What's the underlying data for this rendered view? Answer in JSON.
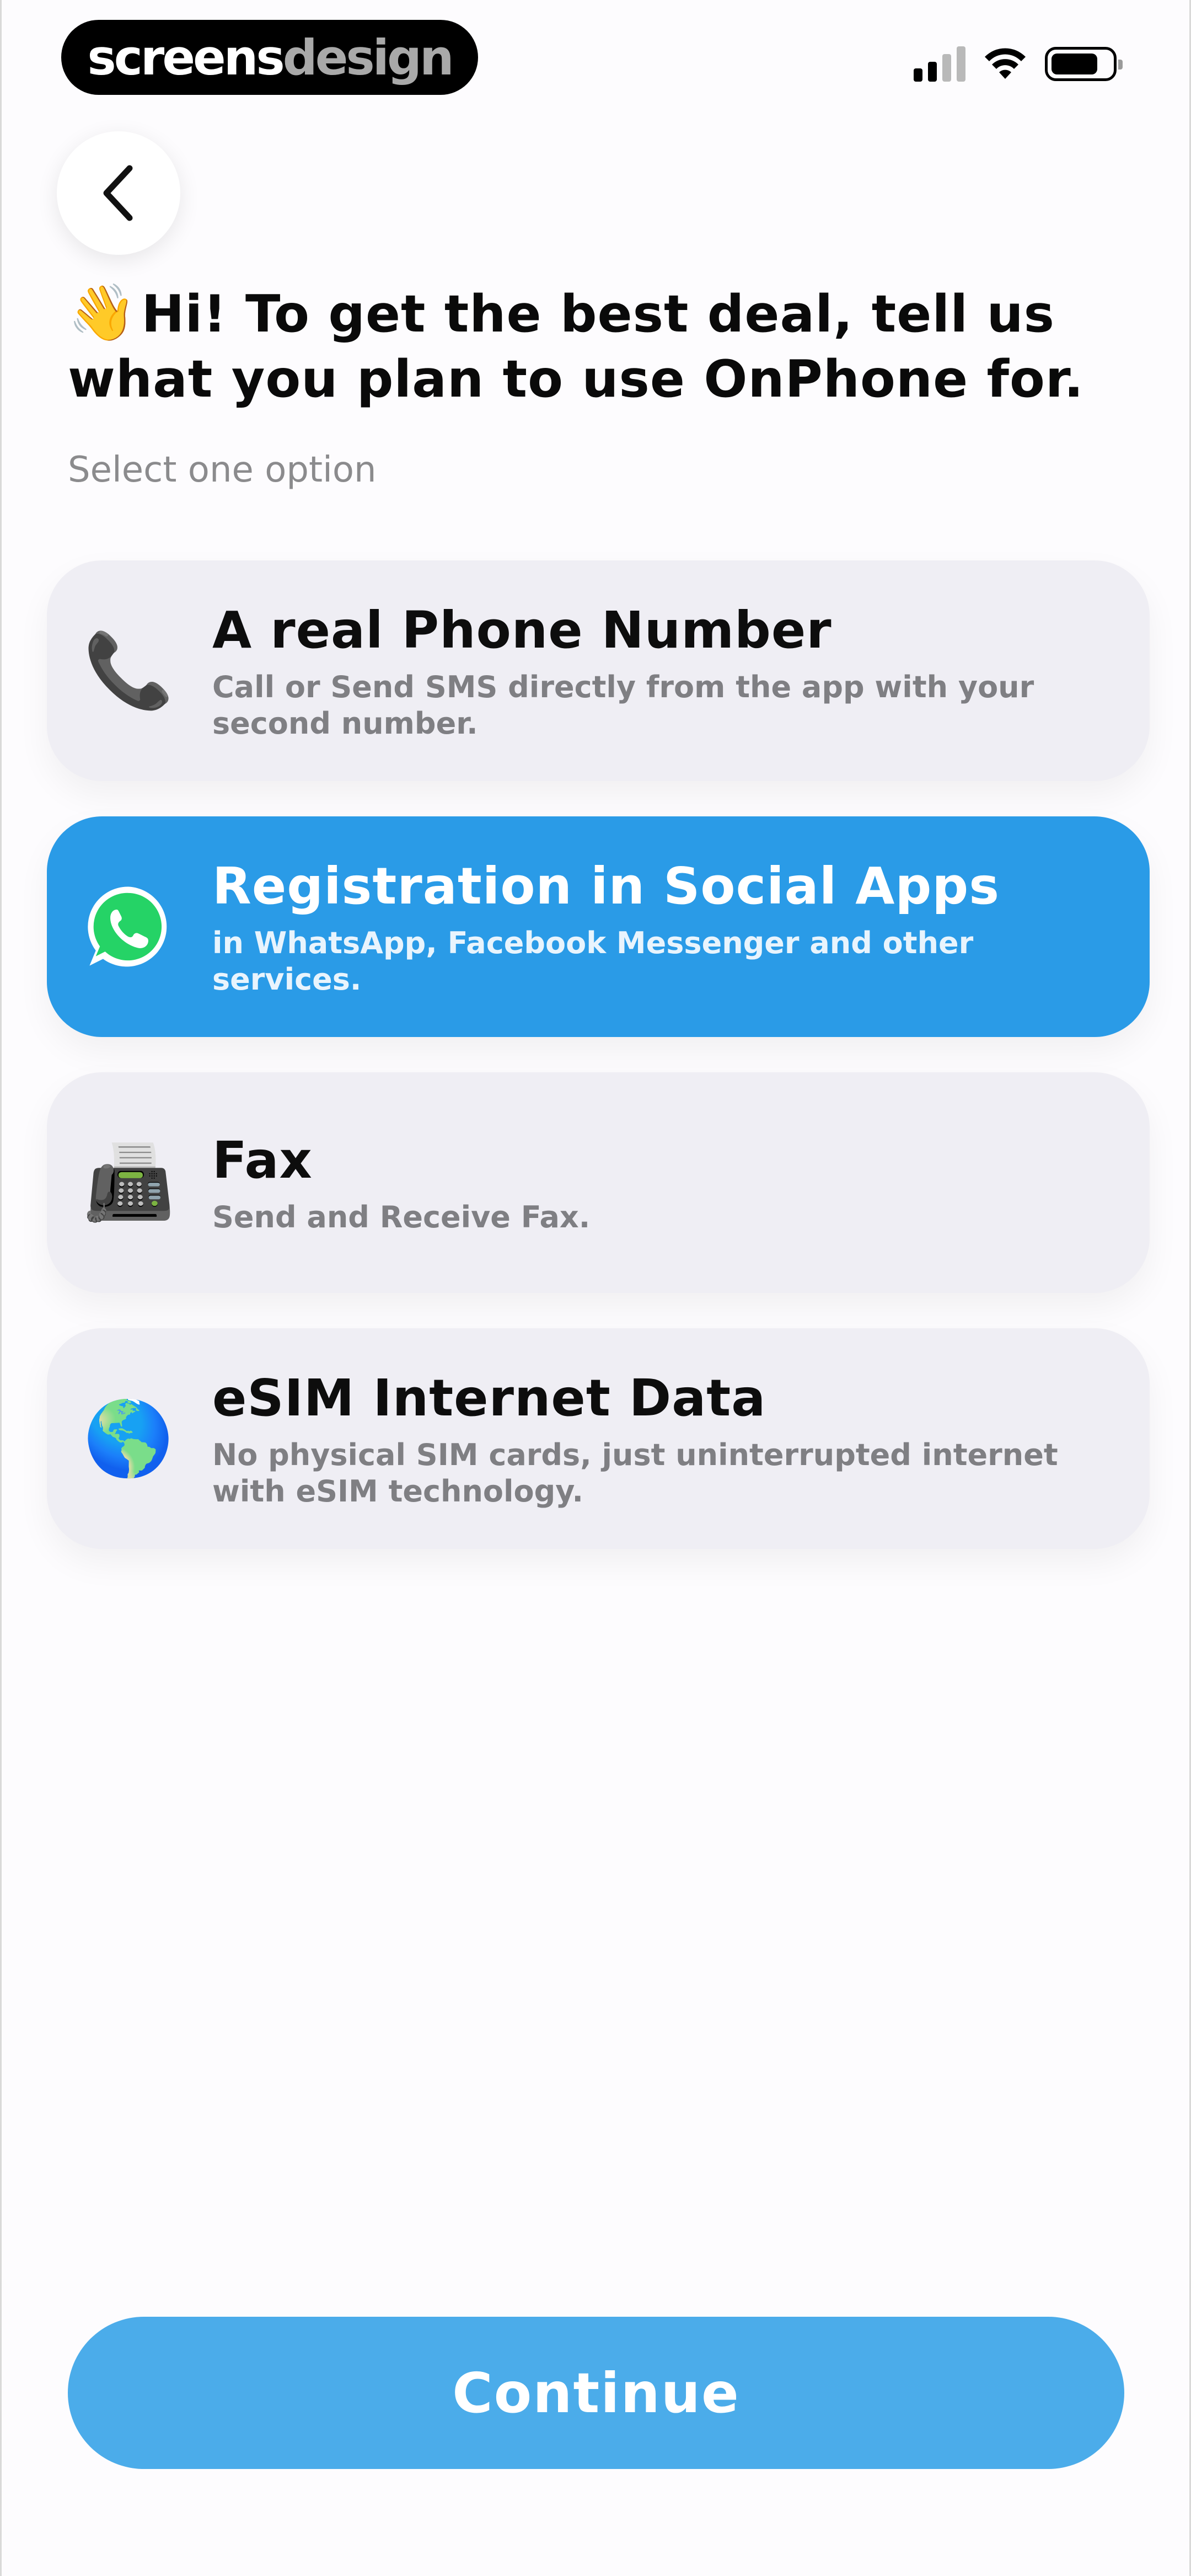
{
  "brand": {
    "logo_part1": "screens",
    "logo_part2": "design"
  },
  "header": {
    "wave_emoji": "👋",
    "title": "Hi! To get the best deal, tell us what you plan to use OnPhone for.",
    "subtitle": "Select one option"
  },
  "options": [
    {
      "icon": "📞",
      "icon_name": "telephone-receiver-icon",
      "title": "A real Phone Number",
      "description": "Call or Send SMS directly from the app with your second number.",
      "selected": false
    },
    {
      "icon_name": "whatsapp-icon",
      "title": "Registration in Social Apps",
      "description": "in WhatsApp, Facebook Messenger and other services.",
      "selected": true
    },
    {
      "icon": "📠",
      "icon_name": "fax-machine-icon",
      "title": "Fax",
      "description": "Send and Receive Fax.",
      "selected": false
    },
    {
      "icon": "🌎",
      "icon_name": "globe-icon",
      "title": "eSIM Internet Data",
      "description": "No physical SIM cards, just uninterrupted internet with eSIM technology.",
      "selected": false
    }
  ],
  "footer": {
    "continue_label": "Continue"
  },
  "colors": {
    "accent": "#2a9be7",
    "continue": "#4bacea",
    "card": "#efeef4",
    "whatsapp": "#25d366"
  }
}
